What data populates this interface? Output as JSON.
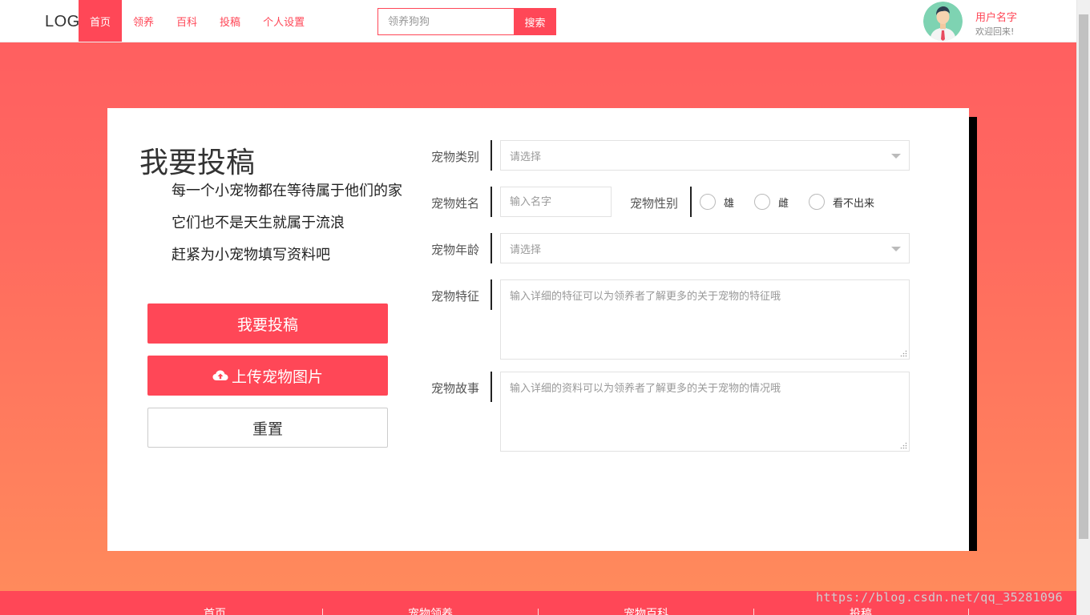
{
  "header": {
    "logo": "LOGO",
    "nav": [
      "首页",
      "领养",
      "百科",
      "投稿",
      "个人设置"
    ],
    "search_placeholder": "领养狗狗",
    "search_button": "搜索",
    "user_name": "用户名字",
    "welcome": "欢迎回来!"
  },
  "intro": {
    "title": "我要投稿",
    "lines": [
      "每一个小宠物都在等待属于他们的家",
      "它们也不是天生就属于流浪",
      "赶紧为小宠物填写资料吧"
    ]
  },
  "buttons": {
    "submit": "我要投稿",
    "upload": "上传宠物图片",
    "reset": "重置"
  },
  "form": {
    "category_label": "宠物类别",
    "category_placeholder": "请选择",
    "name_label": "宠物姓名",
    "name_placeholder": "输入名字",
    "gender_label": "宠物性别",
    "gender_options": [
      "雄",
      "雌",
      "看不出来"
    ],
    "age_label": "宠物年龄",
    "age_placeholder": "请选择",
    "traits_label": "宠物特征",
    "traits_placeholder": "输入详细的特征可以为领养者了解更多的关于宠物的特征哦",
    "story_label": "宠物故事",
    "story_placeholder": "输入详细的资料可以为领养者了解更多的关于宠物的情况哦"
  },
  "footer": {
    "items": [
      "首页",
      "宠物领养",
      "宠物百科",
      "投稿"
    ]
  },
  "watermark": "https://blog.csdn.net/qq_35281096",
  "colors": {
    "accent": "#ff4757",
    "gradient_top": "#ff5f60",
    "gradient_bottom": "#ff8a5c"
  }
}
